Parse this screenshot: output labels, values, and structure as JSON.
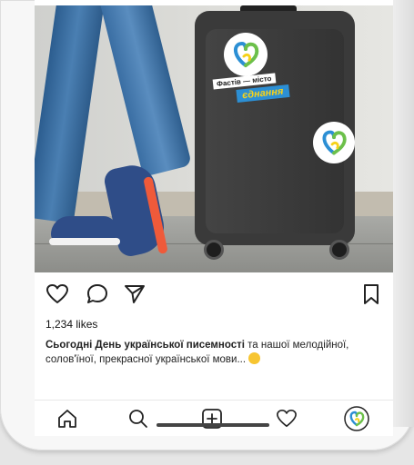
{
  "post": {
    "likes": "1,234 likes",
    "caption_bold": "Сьогодні День української писемності",
    "caption_rest": " та нашої мелодійної, солов'їної, прекрасної української мови... "
  },
  "stickers": {
    "line1": "Фастів — місто",
    "line2": "єднання"
  },
  "icons": {
    "like": "heart-icon",
    "comment": "comment-icon",
    "share": "send-icon",
    "save": "bookmark-icon",
    "home": "home-icon",
    "search": "search-icon",
    "new_post": "add-post-icon",
    "activity": "heart-icon",
    "profile": "avatar"
  },
  "colors": {
    "logo_blue": "#2c8fd4",
    "logo_yellow": "#f6d21a",
    "logo_green": "#6cc04a"
  }
}
